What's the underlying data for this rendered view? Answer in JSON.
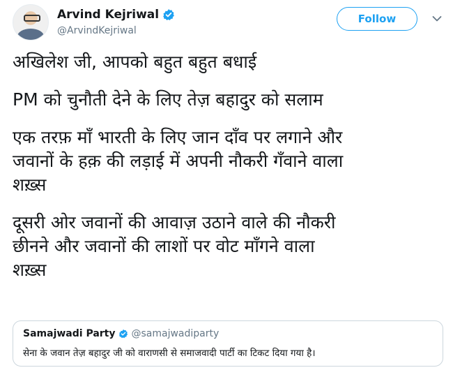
{
  "author": {
    "name": "Arvind Kejriwal",
    "handle": "@ArvindKejriwal",
    "verified_icon": "verified-badge-icon"
  },
  "actions": {
    "follow_label": "Follow",
    "menu_icon": "chevron-down-icon"
  },
  "tweet": {
    "paragraphs": [
      "अखिलेश जी, आपको बहुत बहुत बधाई",
      "PM को चुनौती देने के लिए तेज़ बहादुर को सलाम",
      "एक तरफ़ माँ भारती के लिए जान दाँव पर लगाने और\nजवानों के हक़ की लड़ाई में अपनी नौकरी गँवाने वाला\nशख़्स",
      "दूसरी ओर जवानों की आवाज़ उठाने वाले की नौकरी\nछीनने और जवानों की लाशों पर वोट माँगने वाला\nशख़्स"
    ]
  },
  "quoted_tweet": {
    "name": "Samajwadi Party",
    "handle": "@samajwadiparty",
    "text": "सेना के जवान तेज़ बहादुर जी को वाराणसी से समाजवादी पार्टी का टिकट दिया गया है।"
  },
  "colors": {
    "accent": "#1da1f2",
    "text": "#14171a",
    "secondary": "#657786",
    "border": "#ccd6dd"
  }
}
